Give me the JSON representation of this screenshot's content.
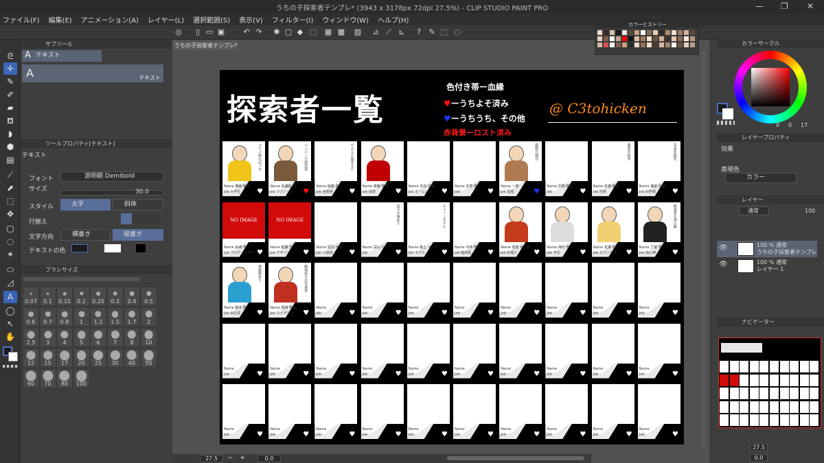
{
  "window": {
    "title": "うちの子探索者テンプレ* (3943 x 3178px 72dpi 27.5%)  - CLIP STUDIO PAINT PRO",
    "min": "—",
    "max": "❐",
    "close": "✕"
  },
  "menu": [
    "ファイル(F)",
    "編集(E)",
    "アニメーション(A)",
    "レイヤー(L)",
    "選択範囲(S)",
    "表示(V)",
    "フィルター(I)",
    "ウィンドウ(W)",
    "ヘルプ(H)"
  ],
  "subtool": {
    "header": "サブツール",
    "item": "テキスト",
    "preview_label": "テキスト"
  },
  "toolprop": {
    "header": "ツールプロパティ[テキスト]",
    "tool_name": "テキスト",
    "font_label": "フォント",
    "font_value": "游明朝 Demibold",
    "size_label": "サイズ",
    "size_value": "30.0",
    "style_label": "スタイル",
    "bold_label": "太字",
    "italic_label": "斜体",
    "align_label": "行揃え",
    "direction_label": "文字方向",
    "horizontal_label": "横書き",
    "vertical_label": "縦書き",
    "color_label": "テキストの色"
  },
  "brushsize": {
    "header": "ブラシサイズ",
    "sizes": [
      "0.07",
      "0.1",
      "0.15",
      "0.2",
      "0.25",
      "0.3",
      "0.4",
      "0.5",
      "0.6",
      "0.7",
      "0.8",
      "1",
      "1.2",
      "1.5",
      "1.7",
      "2",
      "2.5",
      "3",
      "4",
      "5",
      "6",
      "7",
      "8",
      "10",
      "12",
      "15",
      "17",
      "20",
      "25",
      "30",
      "40",
      "50",
      "60",
      "70",
      "80",
      "100"
    ]
  },
  "doc_tab": "うちの子探索者テンプレ*",
  "colorhistory": {
    "header": "カラーヒストリー",
    "colors": [
      "#f2d9c4",
      "#3a2a22",
      "#d7c0a6",
      "#1a1a1a",
      "#f7e8e0",
      "#5a4b3e",
      "#c9a27b",
      "#ffffff",
      "#8c6e58",
      "#e6cfb7",
      "#2c2c2c",
      "#b48a6a",
      "#f0e0d0",
      "#9c7d64",
      "#d2b49c",
      "#5e4a3c",
      "#e8d2bf",
      "#7a5e49",
      "#ffffff",
      "#c0a58e",
      "#ff0000",
      "#111111",
      "#ddbfa6",
      "#a07c5f",
      "#f5e1cf",
      "#6b523f",
      "#cfb198",
      "#3d2f26",
      "#e3c7ae",
      "#8a6a52",
      "#f9ede3",
      "#b8967a",
      "#d4b89f",
      "#e05050",
      "#ffffff",
      "#7d604a",
      "#c89f80",
      "#2a2a2a",
      "#eedccc",
      "#976f52",
      "#f3dfce",
      "#4f3e33",
      "#d9bba1",
      "#a6846a",
      "#ffffff",
      "#6e5542",
      "#e9cfb9",
      "#c2a088"
    ],
    "extra": [
      "#ff0000",
      "#00a000",
      "#0000ff"
    ]
  },
  "sheet": {
    "title": "探索者一覧",
    "legend_band": "色付き帯ー血縁",
    "legend_red": "ーうちよそ済み",
    "legend_blue": "ーうちうち、その他",
    "legend_bg": "赤背景ーロスト済み",
    "handle": "@ C3tohicken",
    "noimage": "NO IMAGE",
    "name_label": "Name",
    "job_label": "Job",
    "names": [
      "霧雨 敏和",
      "長瀬紘 羽",
      "稲森 善一",
      "斉藤 雄馬",
      "天白 正幸",
      "天草 優",
      "一真",
      "羽根 睦仁",
      "倉瀬 鶴利",
      "瀬宮 紗織",
      "糸崎 零",
      "稲瀬 雪",
      "黒羽 弓枝",
      "深山 なと",
      "御上 マリア",
      "平林 雅子",
      "成宮 京之助",
      "神代 翠",
      "花薄 杏",
      "丁宮 零",
      "藤本 剛",
      "狐崎 秀哉"
    ],
    "jobs": [
      "大学生",
      "マジシャン",
      "自衛官",
      "探偵",
      "ホームレス",
      "",
      "医者",
      "",
      "刑事",
      "科学者",
      "プロデューサー",
      "デザイナー",
      "小説家",
      "",
      "モデル",
      "臨床医",
      "料理人",
      "学生",
      "カウンセラー",
      "用心棒",
      "会社員",
      "カメラマン"
    ],
    "notes": [
      "コミュ障なぼっち",
      "ハンバーグ研究家",
      "カメラで見守る人",
      "",
      "",
      "",
      "医師の娘が",
      "",
      "実家が料亭",
      "宇宙を研究",
      "",
      "",
      "",
      "双子の妹あり",
      "ティーンモデル",
      "",
      "",
      "",
      "",
      "美食家な用心棒",
      "事故歴あり",
      "戦地帰りの写真家"
    ]
  },
  "colorcircle": {
    "header": "カラーサークル",
    "h_value": "0",
    "s_value": "0",
    "v_value": "17"
  },
  "layerprop": {
    "header": "レイヤープロパティ",
    "effect_label": "効果",
    "color_label": "表現色",
    "color_value": "カラー"
  },
  "layers": {
    "header": "レイヤー",
    "blend": "通常",
    "opacity": "100",
    "items": [
      {
        "line1": "100 % 通常",
        "line2": "うちの子探索者テンプレ"
      },
      {
        "line1": "100 % 通常",
        "line2": "レイヤー 1"
      }
    ]
  },
  "navigator": {
    "header": "ナビゲーター",
    "zoom": "27.5",
    "angle": "0.0"
  },
  "status": {
    "zoom": "27.5",
    "angle": "0.0"
  }
}
